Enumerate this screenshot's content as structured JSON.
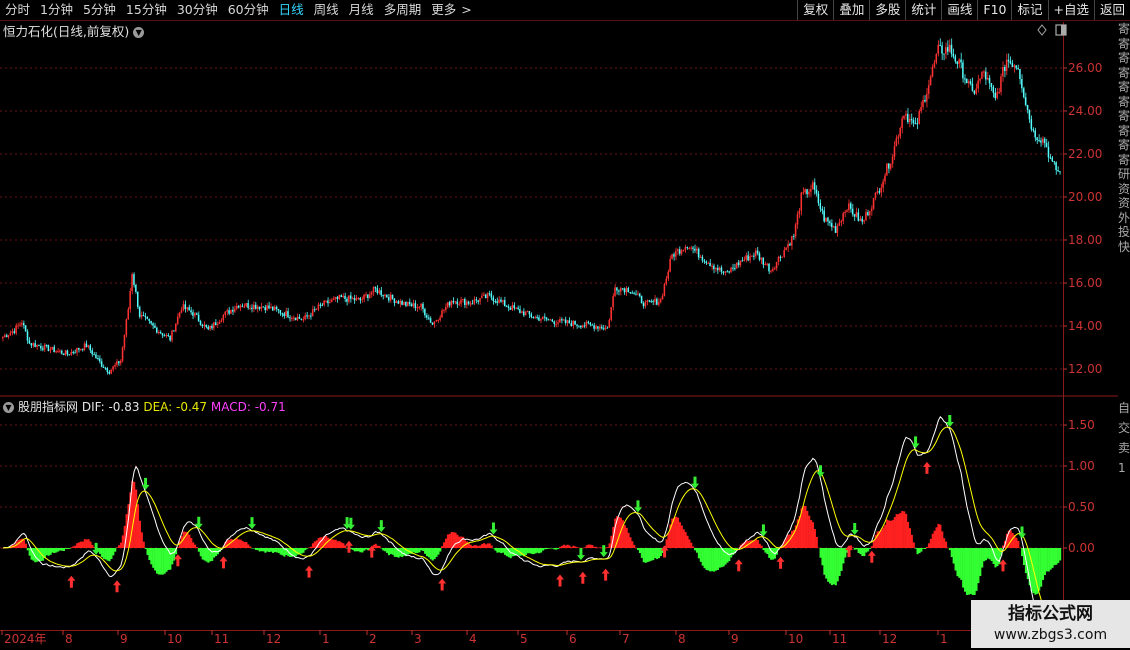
{
  "toolbar": {
    "periods": [
      {
        "label": "分时"
      },
      {
        "label": "1分钟"
      },
      {
        "label": "5分钟"
      },
      {
        "label": "15分钟"
      },
      {
        "label": "30分钟"
      },
      {
        "label": "60分钟"
      },
      {
        "label": "日线",
        "active": true
      },
      {
        "label": "周线"
      },
      {
        "label": "月线"
      },
      {
        "label": "多周期"
      },
      {
        "label": "更多"
      }
    ],
    "more_arrow": ">",
    "tools": [
      "复权",
      "叠加",
      "多股",
      "统计",
      "画线",
      "F10",
      "标记",
      "+自选",
      "返回"
    ]
  },
  "price_panel": {
    "title": "恒力石化(日线,前复权)",
    "y_labels": [
      "26.00",
      "24.00",
      "22.00",
      "20.00",
      "18.00",
      "16.00",
      "14.00",
      "12.00"
    ]
  },
  "indicator_panel": {
    "name": "股朋指标网",
    "dif": "DIF: -0.83",
    "dea": "DEA: -0.47",
    "macd": "MACD: -0.71",
    "y_labels": [
      "1.50",
      "1.00",
      "0.50",
      "0.00"
    ]
  },
  "x_axis": {
    "labels": [
      "2024年",
      "8",
      "9",
      "10",
      "11",
      "12",
      "1",
      "2",
      "3",
      "4",
      "5",
      "6",
      "7",
      "8",
      "9",
      "10",
      "11",
      "12",
      "1"
    ]
  },
  "right_side": {
    "col1": "寄寄寄寄寄寄寄寄寄寄研资资外投快",
    "col2": "自交卖1"
  },
  "watermark": {
    "title": "指标公式网",
    "url": "www.zbgs3.com"
  },
  "colors": {
    "up": "#ff3333",
    "down": "#54ffff",
    "macd_pos": "#ff2020",
    "macd_neg": "#33ff33",
    "dif": "#ffffff",
    "dea": "#ffff00",
    "grid": "#8a1a1a",
    "active_tab": "#33d7ff"
  },
  "chart_data": [
    {
      "type": "candlestick",
      "title": "恒力石化(日线,前复权)",
      "ylim": [
        11.3,
        27.5
      ],
      "x": [
        "2024-07",
        "2024-08",
        "2024-09",
        "2024-10",
        "2024-11",
        "2024-12",
        "2025-01",
        "2025-02",
        "2025-03",
        "2025-04",
        "2025-05",
        "2025-06",
        "2025-07",
        "2025-08",
        "2025-09",
        "2025-10",
        "2025-11",
        "2025-12",
        "2026-01",
        "2026-02"
      ],
      "close": [
        13.4,
        13.1,
        12.1,
        14.6,
        14.1,
        14.8,
        14.5,
        15.1,
        15.6,
        14.9,
        15.2,
        14.6,
        14.1,
        15.3,
        17.3,
        16.8,
        19.6,
        18.7,
        25.9,
        21.0
      ],
      "up_color": "#ff3333",
      "down_color": "#54ffff"
    },
    {
      "type": "bar+line",
      "title": "股朋指标网",
      "ylim": [
        -1.2,
        1.65
      ],
      "x": [
        "2024-07",
        "2024-08",
        "2024-09",
        "2024-10",
        "2024-11",
        "2024-12",
        "2025-01",
        "2025-02",
        "2025-03",
        "2025-04",
        "2025-05",
        "2025-06",
        "2025-07",
        "2025-08",
        "2025-09",
        "2025-10",
        "2025-11",
        "2025-12",
        "2026-01",
        "2026-02"
      ],
      "series": [
        {
          "name": "DIF",
          "values": [
            -0.1,
            -0.15,
            -0.3,
            0.45,
            0.1,
            0.2,
            -0.05,
            0.15,
            0.1,
            -0.1,
            0.05,
            -0.1,
            -0.2,
            0.35,
            0.7,
            0.1,
            0.8,
            0.4,
            1.55,
            -0.83
          ]
        },
        {
          "name": "DEA",
          "values": [
            -0.05,
            -0.1,
            -0.25,
            0.3,
            0.15,
            0.15,
            0.0,
            0.1,
            0.12,
            -0.05,
            0.03,
            -0.08,
            -0.15,
            0.25,
            0.55,
            0.15,
            0.6,
            0.45,
            1.3,
            -0.47
          ]
        },
        {
          "name": "MACD",
          "values": [
            0.1,
            -0.2,
            -0.3,
            0.75,
            0.25,
            0.2,
            -0.1,
            0.15,
            0.2,
            -0.2,
            0.1,
            -0.15,
            -0.3,
            0.4,
            0.45,
            -0.3,
            0.55,
            -0.25,
            0.65,
            -0.71
          ]
        }
      ]
    }
  ]
}
